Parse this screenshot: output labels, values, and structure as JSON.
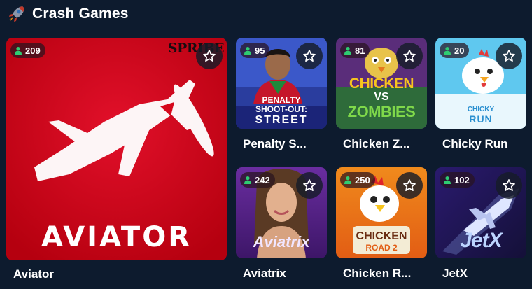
{
  "section": {
    "title": "Crash Games",
    "icon": "rocket-icon"
  },
  "games": {
    "aviator": {
      "title": "Aviator",
      "players": "209",
      "art_text": "AVIATOR",
      "provider_mark": "SPRIBE"
    },
    "penalty": {
      "title": "Penalty S...",
      "players": "95",
      "art_line1": "PENALTY",
      "art_line2": "SHOOT-OUT:",
      "art_line3": "STREET"
    },
    "chicken_zombies": {
      "title": "Chicken Z...",
      "players": "81",
      "art_line1": "CHICKEN",
      "art_line2": "VS",
      "art_line3": "ZOMBIES"
    },
    "chicky": {
      "title": "Chicky Run",
      "players": "20",
      "art_line1": "CHICKY",
      "art_line2": "RUN"
    },
    "aviatrix": {
      "title": "Aviatrix",
      "players": "242",
      "art_text": "Aviatrix"
    },
    "chicken_road": {
      "title": "Chicken R...",
      "players": "250",
      "art_line1": "CHICKEN",
      "art_line2": "ROAD 2"
    },
    "jetx": {
      "title": "JetX",
      "players": "102",
      "art_text": "JetX"
    }
  },
  "icons": {
    "players": "user-icon",
    "favorite": "star-outline-icon"
  },
  "colors": {
    "background": "#0d1b2e",
    "players_icon": "#2ecc71",
    "aviator_red": "#d6081c"
  }
}
